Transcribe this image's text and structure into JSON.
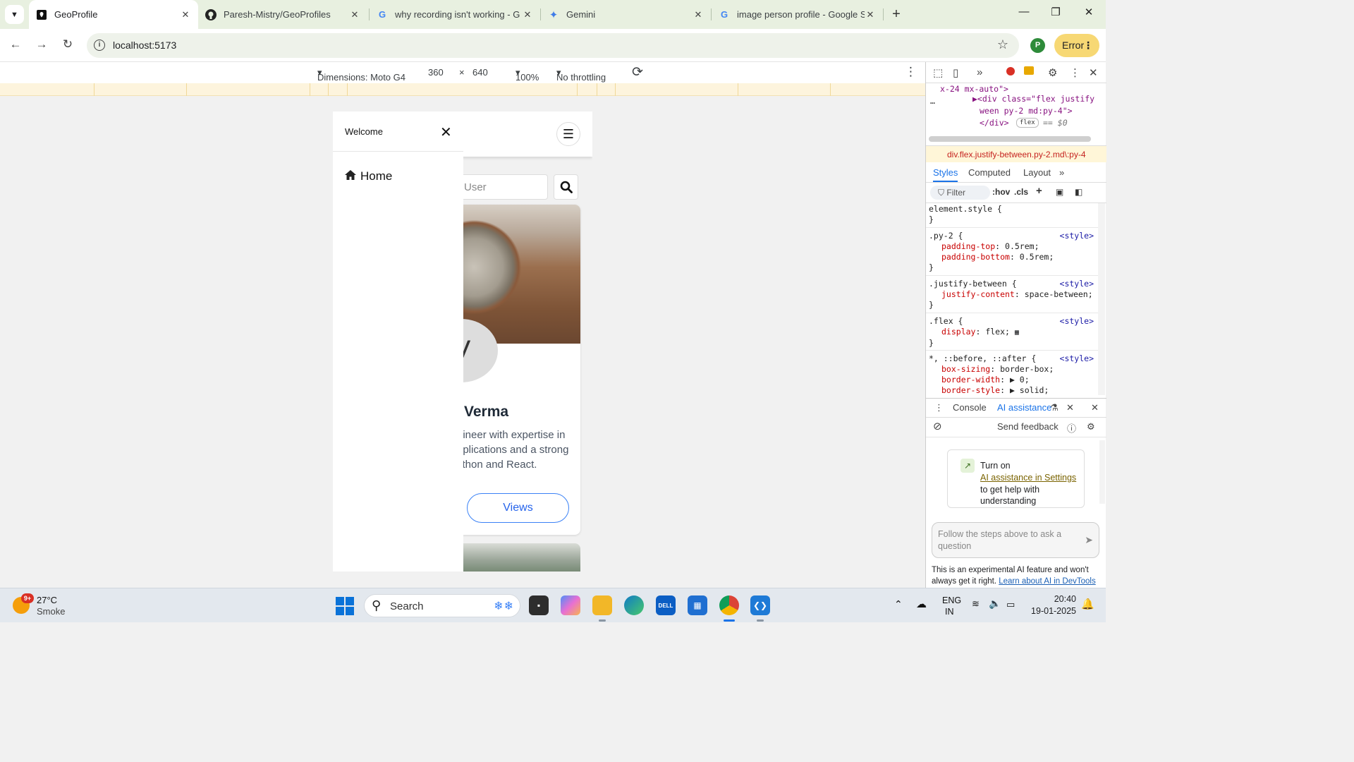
{
  "browser": {
    "tabs": [
      {
        "title": "GeoProfile",
        "icon": "map-pin-icon",
        "active": true
      },
      {
        "title": "Paresh-Mistry/GeoProfiles",
        "icon": "github-icon",
        "active": false
      },
      {
        "title": "why recording isn't working - G",
        "icon": "google-icon",
        "active": false
      },
      {
        "title": "Gemini",
        "icon": "gemini-icon",
        "active": false
      },
      {
        "title": "image person profile - Google S",
        "icon": "google-icon",
        "active": false
      }
    ],
    "url": "localhost:5173",
    "profile_initial": "P",
    "error_label": "Error"
  },
  "device_toolbar": {
    "dimensions_label": "Dimensions: Moto G4",
    "width": "360",
    "times": "×",
    "height": "640",
    "zoom": "100%",
    "throttling": "No throttling"
  },
  "app": {
    "search_placeholder": "rch User",
    "drawer": {
      "title": "Welcome",
      "close": "✕",
      "home_label": "Home"
    },
    "profile_card": {
      "avatar_initial": "V",
      "name": "Verma",
      "bio": "gineer with expertise in pplications and a strong ython and React.",
      "views_label": "Views"
    }
  },
  "devtools": {
    "dom_lines": [
      "x-24 mx-auto\">",
      "▶<div class=\"flex justify",
      "ween  py-2 md:py-4\">",
      "</div>",
      "== $0"
    ],
    "dom_badge": "flex",
    "breadcrumb": "div.flex.justify-between.py-2.md\\:py-4",
    "tabs": [
      "Styles",
      "Computed",
      "Layout",
      "»"
    ],
    "filter_placeholder": "Filter",
    "hov": ":hov",
    "cls": ".cls",
    "rules": [
      {
        "selector": "element.style {",
        "source": "",
        "decls": []
      },
      {
        "selector": ".py-2 {",
        "source": "<style>",
        "decls": [
          [
            "padding-top",
            "0.5rem;"
          ],
          [
            "padding-bottom",
            "0.5rem;"
          ]
        ]
      },
      {
        "selector": ".justify-between {",
        "source": "<style>",
        "decls": [
          [
            "justify-content",
            "space-between;"
          ]
        ]
      },
      {
        "selector": ".flex {",
        "source": "<style>",
        "decls": [
          [
            "display",
            "flex;"
          ]
        ]
      },
      {
        "selector": "*, ::before, ::after {",
        "source": "<style>",
        "decls": [
          [
            "box-sizing",
            "border-box;"
          ],
          [
            "border-width",
            "▶ 0;"
          ],
          [
            "border-style",
            "▶ solid;"
          ]
        ]
      }
    ],
    "drawer_tabs": [
      "Console",
      "AI assistance"
    ],
    "send_feedback": "Send feedback",
    "ai_card": {
      "line1": "Turn on",
      "link": "AI assistance in Settings",
      "line3": "to get help with understanding"
    },
    "ai_input_placeholder": "Follow the steps above to ask a question",
    "footer_text": "This is an experimental AI feature and won't always get it right.",
    "footer_link": "Learn about AI in DevTools"
  },
  "taskbar": {
    "weather_badge": "9+",
    "temperature": "27°C",
    "condition": "Smoke",
    "search_label": "Search",
    "language": "ENG",
    "region": "IN",
    "time": "20:40",
    "date": "19-01-2025"
  }
}
